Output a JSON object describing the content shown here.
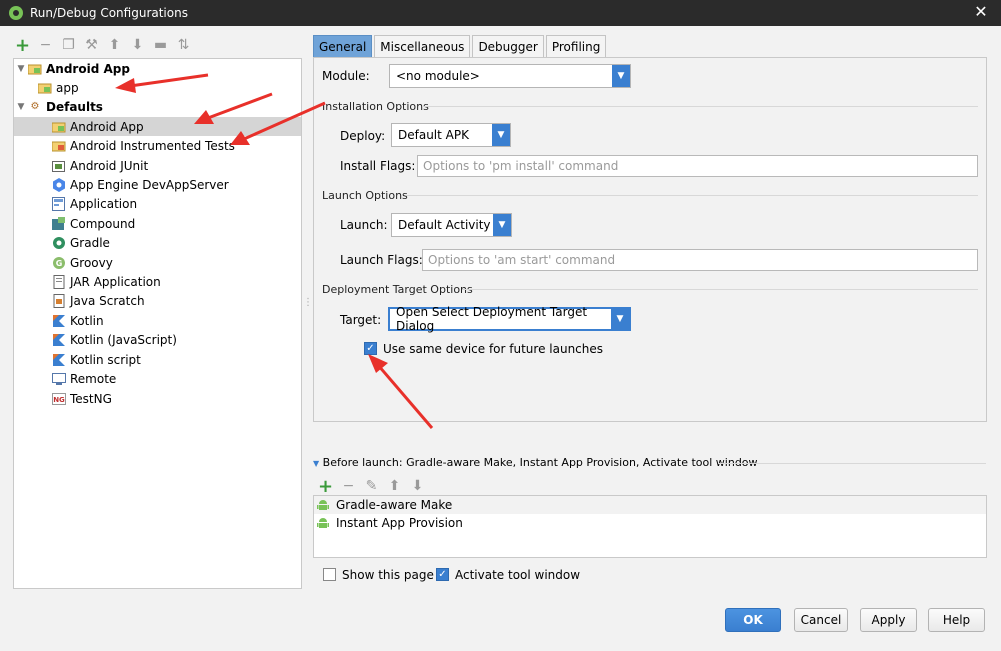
{
  "window": {
    "title": "Run/Debug Configurations"
  },
  "tree": {
    "items": [
      {
        "label": "Android App",
        "level": 0,
        "bold": true,
        "expanded": true,
        "icon": "android-app-icon"
      },
      {
        "label": "app",
        "level": 1,
        "bold": false,
        "icon": "android-app-icon"
      },
      {
        "label": "Defaults",
        "level": 0,
        "bold": true,
        "expanded": true,
        "icon": "wrench-icon"
      },
      {
        "label": "Android App",
        "level": 1,
        "selected": true,
        "icon": "android-app-icon"
      },
      {
        "label": "Android Instrumented Tests",
        "level": 1,
        "icon": "android-test-icon"
      },
      {
        "label": "Android JUnit",
        "level": 1,
        "icon": "junit-icon"
      },
      {
        "label": "App Engine DevAppServer",
        "level": 1,
        "icon": "app-engine-icon"
      },
      {
        "label": "Application",
        "level": 1,
        "icon": "application-icon"
      },
      {
        "label": "Compound",
        "level": 1,
        "icon": "compound-icon"
      },
      {
        "label": "Gradle",
        "level": 1,
        "icon": "gradle-icon"
      },
      {
        "label": "Groovy",
        "level": 1,
        "icon": "groovy-icon"
      },
      {
        "label": "JAR Application",
        "level": 1,
        "icon": "jar-icon"
      },
      {
        "label": "Java Scratch",
        "level": 1,
        "icon": "java-scratch-icon"
      },
      {
        "label": "Kotlin",
        "level": 1,
        "icon": "kotlin-icon"
      },
      {
        "label": "Kotlin (JavaScript)",
        "level": 1,
        "icon": "kotlin-icon"
      },
      {
        "label": "Kotlin script",
        "level": 1,
        "icon": "kotlin-icon"
      },
      {
        "label": "Remote",
        "level": 1,
        "icon": "remote-icon"
      },
      {
        "label": "TestNG",
        "level": 1,
        "icon": "testng-icon"
      }
    ]
  },
  "tabs": [
    "General",
    "Miscellaneous",
    "Debugger",
    "Profiling"
  ],
  "general": {
    "module_label": "Module:",
    "module_value": "<no module>",
    "installation_section": "Installation Options",
    "deploy_label": "Deploy:",
    "deploy_value": "Default APK",
    "install_flags_label": "Install Flags:",
    "install_flags_placeholder": "Options to 'pm install' command",
    "launch_section": "Launch Options",
    "launch_label": "Launch:",
    "launch_value": "Default Activity",
    "launch_flags_label": "Launch Flags:",
    "launch_flags_placeholder": "Options to 'am start' command",
    "deployment_section": "Deployment Target Options",
    "target_label": "Target:",
    "target_value": "Open Select Deployment Target Dialog",
    "same_device_label": "Use same device for future launches",
    "same_device_checked": true
  },
  "before_launch": {
    "header": "Before launch: Gradle-aware Make, Instant App Provision, Activate tool window",
    "items": [
      "Gradle-aware Make",
      "Instant App Provision"
    ]
  },
  "footer": {
    "show_this_page": "Show this page",
    "show_this_page_checked": false,
    "activate_tool_window": "Activate tool window",
    "activate_tool_window_checked": true
  },
  "buttons": {
    "ok": "OK",
    "cancel": "Cancel",
    "apply": "Apply",
    "help": "Help"
  },
  "colors": {
    "accent": "#3a7fd0",
    "selected_tab": "#6fa3d8",
    "title_bar": "#2b2b2b",
    "annotation": "#e8302a"
  }
}
